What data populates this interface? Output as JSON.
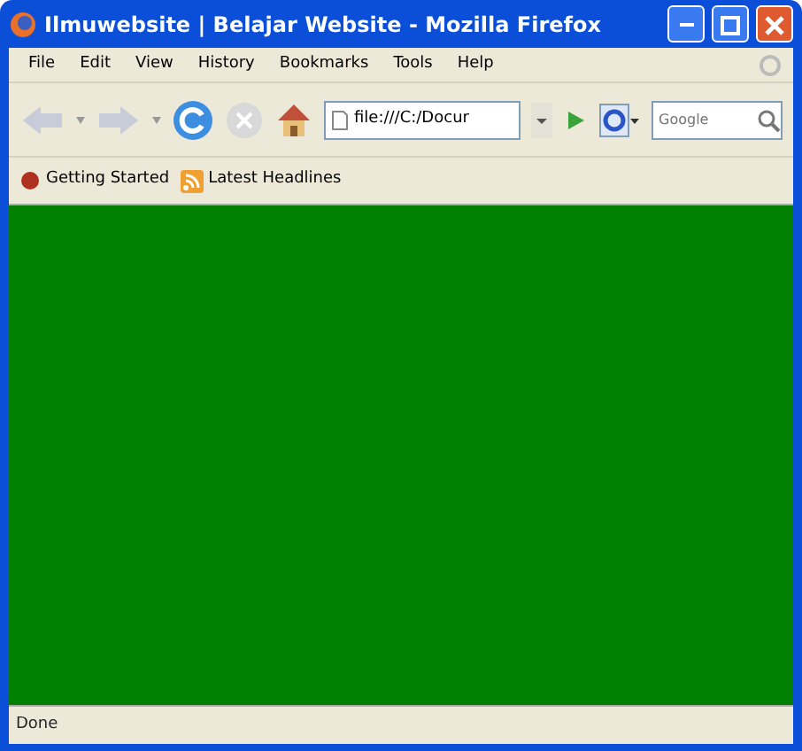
{
  "window": {
    "title": "Ilmuwebsite | Belajar Website - Mozilla Firefox"
  },
  "menu": [
    "File",
    "Edit",
    "View",
    "History",
    "Bookmarks",
    "Tools",
    "Help"
  ],
  "address": {
    "value": "file:///C:/Docur"
  },
  "search": {
    "placeholder": "Google"
  },
  "bookmarks": [
    {
      "label": "Getting Started",
      "kind": "page"
    },
    {
      "label": "Latest Headlines",
      "kind": "feed"
    }
  ],
  "content": {
    "color": "#007f00"
  },
  "status_bar": {
    "text": "Done"
  }
}
